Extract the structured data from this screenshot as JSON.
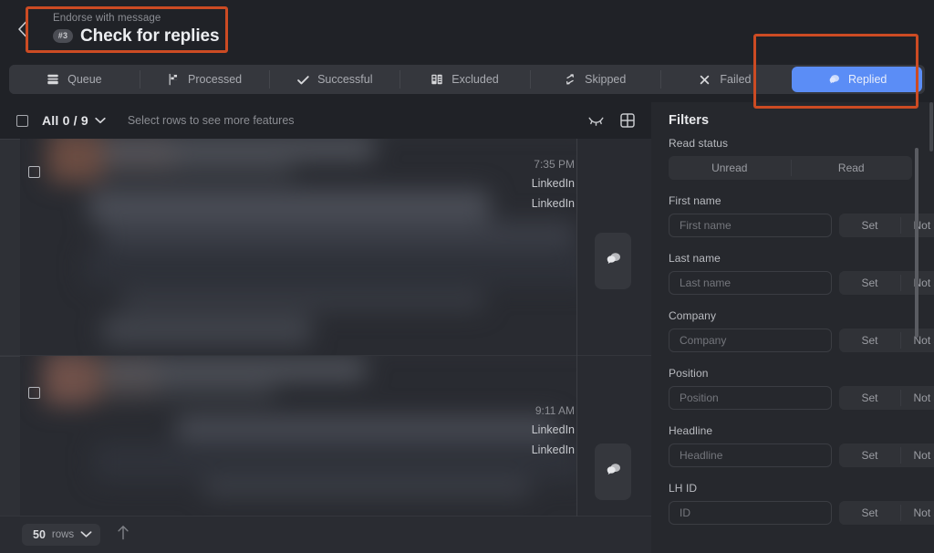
{
  "theme": {
    "bg": "#202227",
    "panel": "#26282d",
    "surface": "#35373d",
    "accent_blue": "#5b8df6",
    "annotation_orange": "#cc4b23",
    "text_primary": "#e8e9ec",
    "text_muted": "#8b8d93"
  },
  "header": {
    "back_icon": "chevron-left-icon",
    "eyebrow": "Endorse with message",
    "step_badge": "#3",
    "title": "Check for replies"
  },
  "tabs": [
    {
      "label": "Queue",
      "icon": "inbox-icon",
      "active": false
    },
    {
      "label": "Processed",
      "icon": "flag-icon",
      "active": false
    },
    {
      "label": "Successful",
      "icon": "check-icon",
      "active": false
    },
    {
      "label": "Excluded",
      "icon": "excluded-icon",
      "active": false
    },
    {
      "label": "Skipped",
      "icon": "skip-arrows-icon",
      "active": false
    },
    {
      "label": "Failed",
      "icon": "x-icon",
      "active": false
    },
    {
      "label": "Replied",
      "icon": "chat-bubble-icon",
      "active": true
    }
  ],
  "toolbar": {
    "select_all_checkbox": "select-all-checkbox",
    "all_label": "All 0 / 9",
    "chevron_icon": "chevron-down-icon",
    "hint": "Select rows to see more features",
    "icons": [
      {
        "name": "collapse-rows-icon"
      },
      {
        "name": "grid-view-icon"
      }
    ]
  },
  "list": {
    "rows": [
      {
        "time": "7:35 PM",
        "source": "LinkedIn",
        "channel": "LinkedIn",
        "action_icon": "chat-bubbles-icon",
        "redacted": true
      },
      {
        "time": "9:11 AM",
        "source": "LinkedIn",
        "channel": "LinkedIn",
        "action_icon": "chat-bubbles-icon",
        "redacted": true
      }
    ]
  },
  "bottom_bar": {
    "rows_count": "50",
    "rows_word": "rows",
    "chevron_icon": "chevron-down-icon",
    "scroll_top_icon": "arrow-up-icon"
  },
  "filters": {
    "title": "Filters",
    "groups": [
      {
        "label": "Read status",
        "type": "segmented",
        "options": [
          "Unread",
          "Read"
        ]
      },
      {
        "label": "First name",
        "type": "input_with_segmented",
        "placeholder": "First name",
        "value": "",
        "options": [
          "Set",
          "Not set"
        ]
      },
      {
        "label": "Last name",
        "type": "input_with_segmented",
        "placeholder": "Last name",
        "value": "",
        "options": [
          "Set",
          "Not set"
        ]
      },
      {
        "label": "Company",
        "type": "input_with_segmented",
        "placeholder": "Company",
        "value": "",
        "options": [
          "Set",
          "Not set"
        ]
      },
      {
        "label": "Position",
        "type": "input_with_segmented",
        "placeholder": "Position",
        "value": "",
        "options": [
          "Set",
          "Not set"
        ]
      },
      {
        "label": "Headline",
        "type": "input_with_segmented",
        "placeholder": "Headline",
        "value": "",
        "options": [
          "Set",
          "Not set"
        ]
      },
      {
        "label": "LH ID",
        "type": "input_with_segmented",
        "placeholder": "ID",
        "value": "",
        "options": [
          "Set",
          "Not set"
        ]
      }
    ]
  }
}
